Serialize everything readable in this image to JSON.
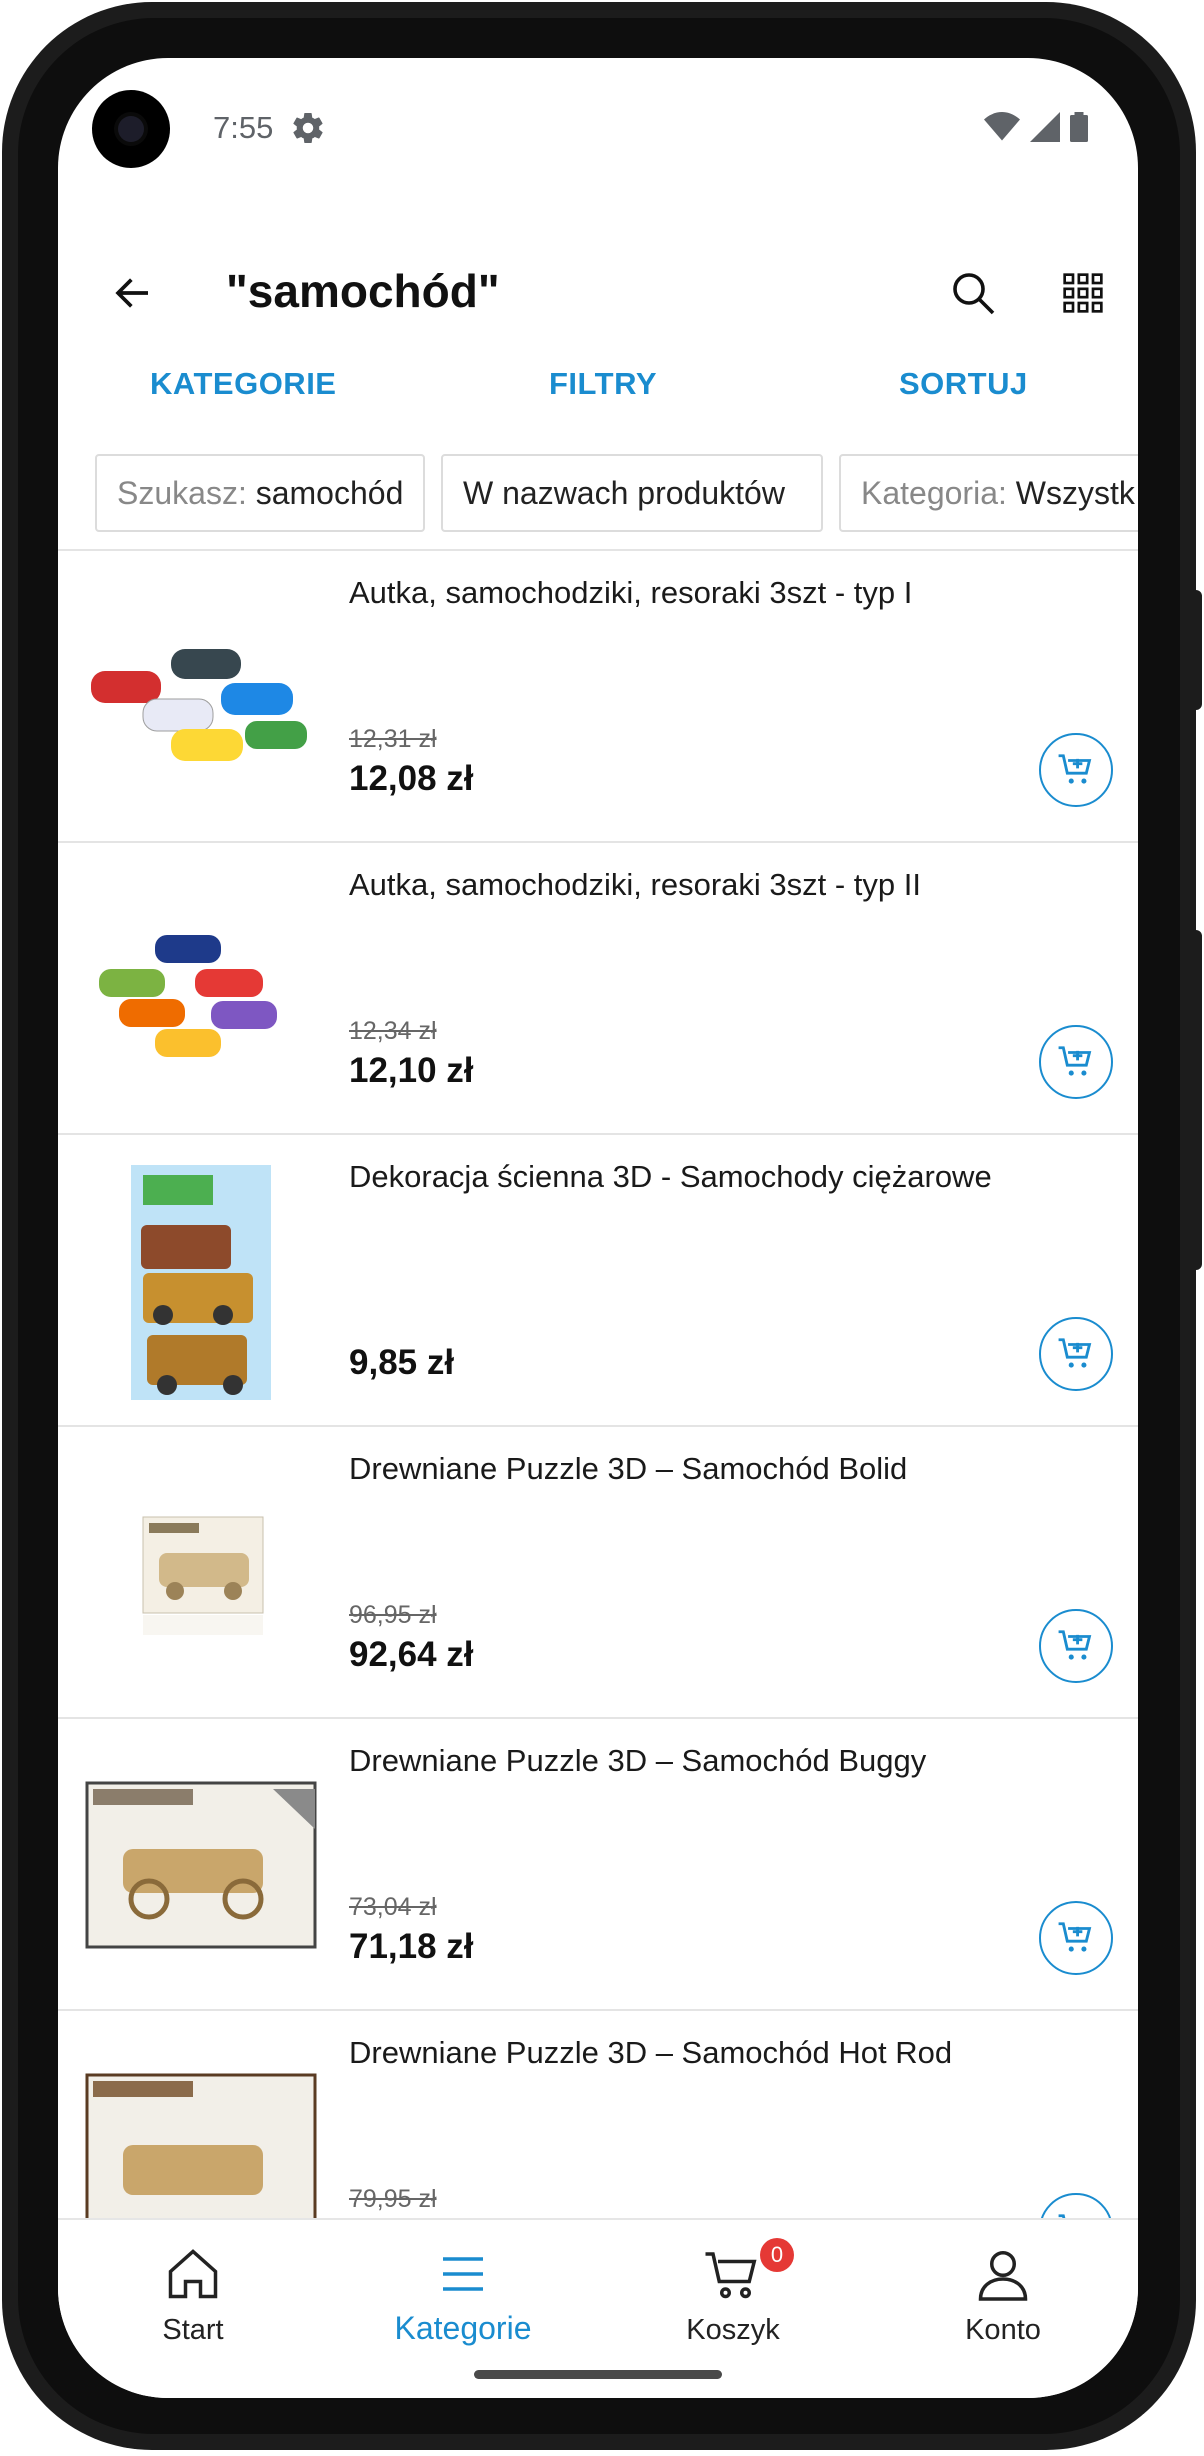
{
  "status_bar": {
    "time": "7:55"
  },
  "app_bar": {
    "title": "\"samochód\""
  },
  "tabs": [
    {
      "label": "KATEGORIE"
    },
    {
      "label": "FILTRY"
    },
    {
      "label": "SORTUJ"
    }
  ],
  "chips": [
    {
      "key": "Szukasz:",
      "value": "samochód"
    },
    {
      "key": "",
      "value": "W nazwach produktów"
    },
    {
      "key": "Kategoria:",
      "value": "Wszystk"
    }
  ],
  "products": [
    {
      "name": "Autka, samochodziki, resoraki 3szt - typ I",
      "old_price": "12,31 zł",
      "price": "12,08 zł"
    },
    {
      "name": "Autka, samochodziki, resoraki 3szt - typ II",
      "old_price": "12,34 zł",
      "price": "12,10 zł"
    },
    {
      "name": "Dekoracja ścienna 3D - Samochody ciężarowe",
      "old_price": "",
      "price": "9,85 zł"
    },
    {
      "name": "Drewniane Puzzle 3D – Samochód Bolid",
      "old_price": "96,95 zł",
      "price": "92,64 zł"
    },
    {
      "name": "Drewniane Puzzle 3D – Samochód Buggy",
      "old_price": "73,04 zł",
      "price": "71,18 zł"
    },
    {
      "name": "Drewniane Puzzle 3D – Samochód Hot Rod",
      "old_price": "79,95 zł",
      "price": ""
    }
  ],
  "bottom_nav": [
    {
      "label": "Start",
      "icon": "home-icon"
    },
    {
      "label": "Kategorie",
      "icon": "menu-icon"
    },
    {
      "label": "Koszyk",
      "icon": "cart-icon",
      "badge": "0"
    },
    {
      "label": "Konto",
      "icon": "person-icon"
    }
  ],
  "colors": {
    "accent": "#1a8ccf",
    "badge": "#e53935"
  }
}
